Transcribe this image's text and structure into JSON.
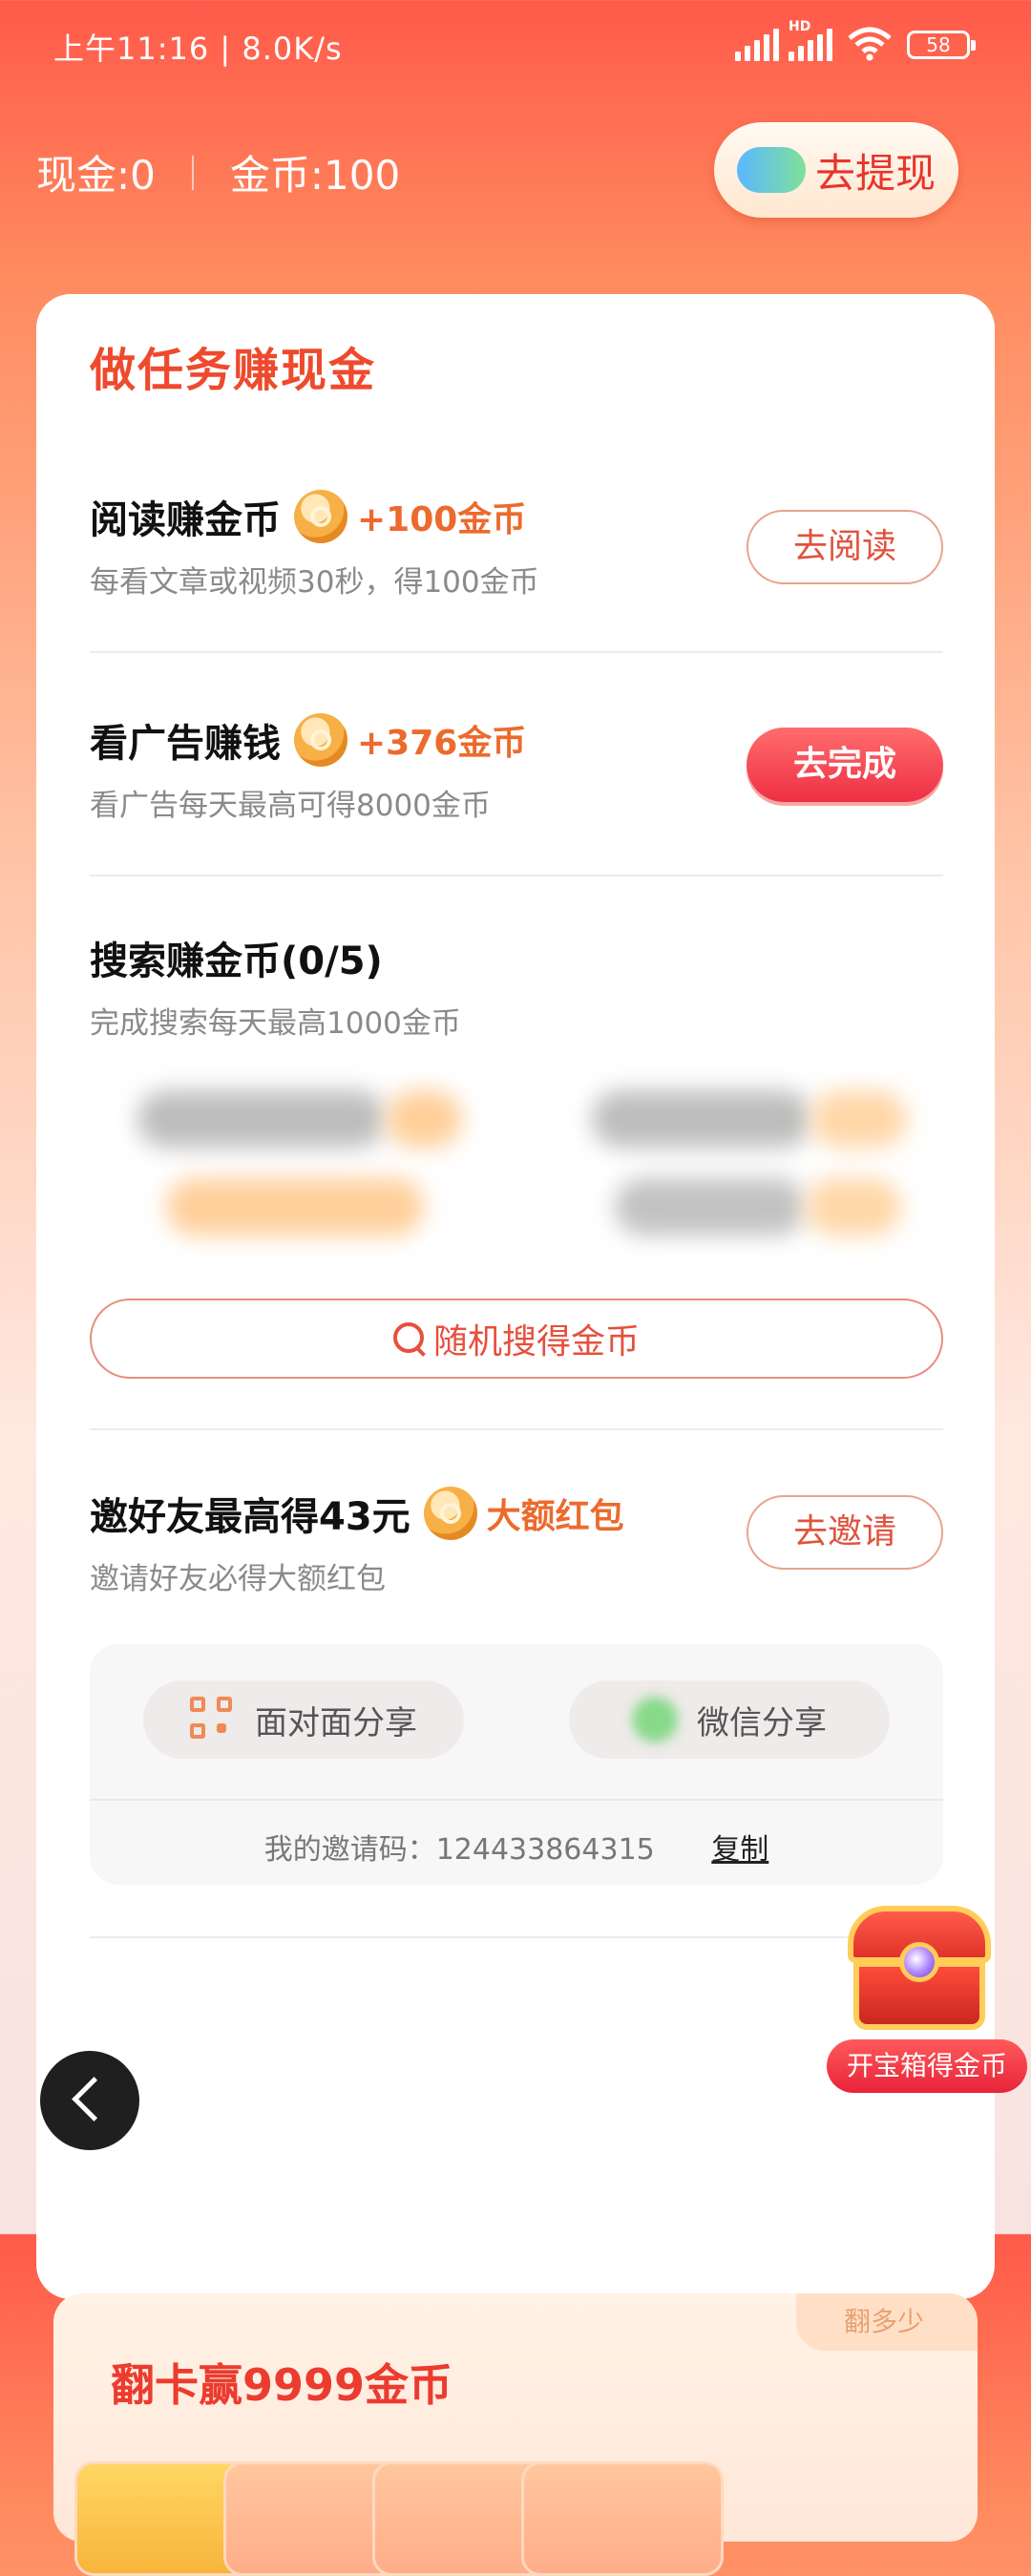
{
  "status_bar": {
    "time": "上午11:16 | 8.0K/s",
    "network_label": "HD",
    "battery": "58"
  },
  "header": {
    "cash": "现金:0",
    "coins": "金币:100",
    "withdraw_label": "去提现"
  },
  "card": {
    "title": "做任务赚现金",
    "tasks": [
      {
        "name": "阅读赚金币",
        "reward": "+100金币",
        "desc": "每看文章或视频30秒，得100金币",
        "button": "去阅读"
      },
      {
        "name": "看广告赚钱",
        "reward": "+376金币",
        "desc": "看广告每天最高可得8000金币",
        "button": "去完成"
      },
      {
        "name": "搜索赚金币(0/5)",
        "desc": "完成搜索每天最高1000金币",
        "random_button": "随机搜得金币"
      },
      {
        "name": "邀好友最高得43元",
        "reward": "大额红包",
        "desc": "邀请好友必得大额红包",
        "button": "去邀请"
      }
    ],
    "share": {
      "face_to_face": "面对面分享",
      "wechat": "微信分享",
      "invite_code": "我的邀请码：124433864315",
      "copy": "复制"
    }
  },
  "flip_section": {
    "title": "翻卡赢9999金币",
    "tag": "翻多少"
  },
  "treasure": {
    "label": "开宝箱得金币"
  },
  "colors": {
    "accent": "#ee4a2d",
    "reward": "#ec6a2d",
    "primary_button": "#ef2f45"
  }
}
